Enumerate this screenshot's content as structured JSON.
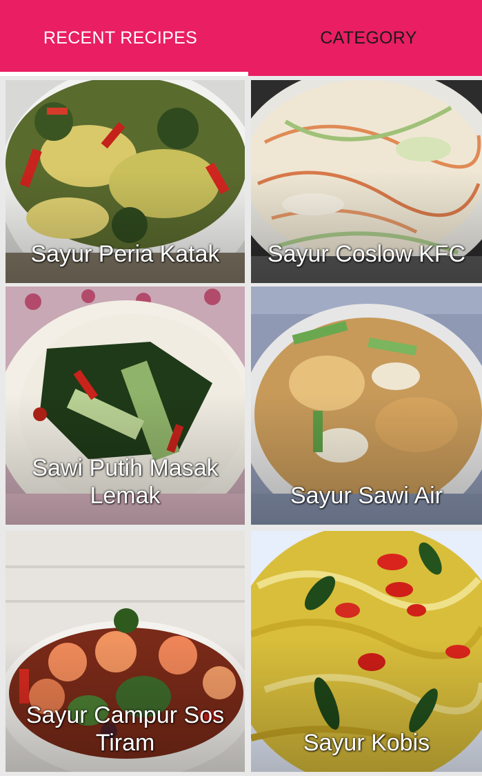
{
  "tabs": [
    {
      "label": "RECENT RECIPES",
      "selected": true
    },
    {
      "label": "CATEGORY",
      "selected": false
    }
  ],
  "colors": {
    "tabbar": "#e91e63",
    "tab_selected_text": "#ffffff",
    "tab_unselected_text": "#1a1a1a",
    "indicator": "#ffffff"
  },
  "recipes": [
    {
      "title": "Sayur Peria Katak"
    },
    {
      "title": "Sayur Coslow KFC"
    },
    {
      "title": "Sawi Putih Masak Lemak"
    },
    {
      "title": "Sayur Sawi Air"
    },
    {
      "title": "Sayur Campur Sos Tiram"
    },
    {
      "title": "Sayur Kobis"
    }
  ]
}
